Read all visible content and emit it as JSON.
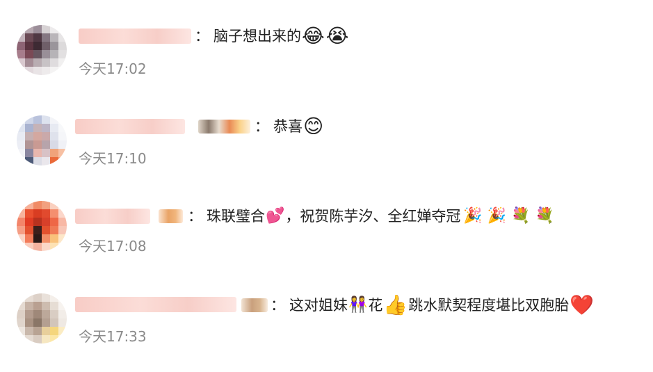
{
  "comments": [
    {
      "text": "脑子想出来的",
      "emojis": [
        "😂",
        "😭"
      ],
      "time": "今天17:02",
      "icons": [
        "laughing-tears-icon",
        "crying-hands-icon"
      ]
    },
    {
      "text": "恭喜",
      "emojis": [
        "😊"
      ],
      "time": "今天17:10",
      "icons": [
        "blush-hands-icon"
      ]
    },
    {
      "text_a": "珠联璧合",
      "emoji_a": "💕",
      "text_b": "，祝贺陈芋汐、全红婵夺冠",
      "emojis_b": [
        "🎉",
        "🎉",
        "💐",
        "💐"
      ],
      "time": "今天17:08",
      "icons": [
        "hearts-icon",
        "party-popper-icon",
        "bouquet-icon"
      ]
    },
    {
      "text_a": "这对姐妹",
      "emoji_a": "👭",
      "text_b": "花",
      "emoji_b": "👍",
      "text_c": "跳水默契程度堪比双胞胎",
      "emoji_c": "❤️",
      "time": "今天17:33",
      "icons": [
        "two-women-icon",
        "thumbs-up-icon",
        "red-heart-icon"
      ]
    }
  ],
  "colon": "："
}
